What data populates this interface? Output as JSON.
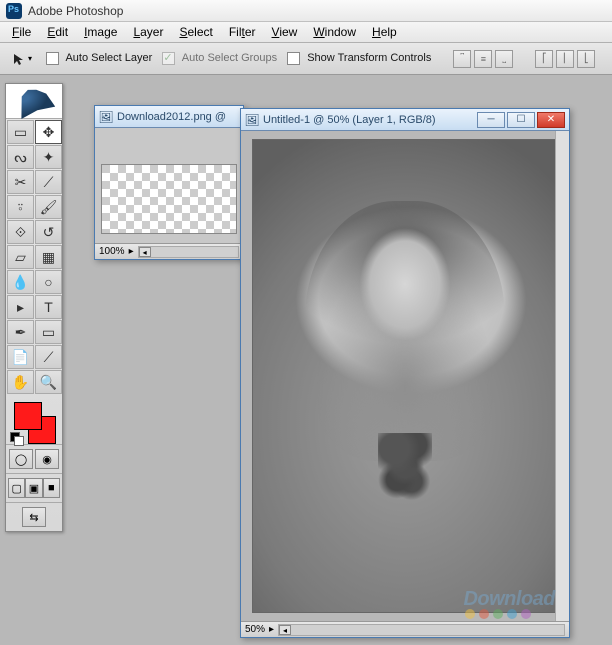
{
  "app": {
    "title": "Adobe Photoshop"
  },
  "menu": {
    "items": [
      "File",
      "Edit",
      "Image",
      "Layer",
      "Select",
      "Filter",
      "View",
      "Window",
      "Help"
    ]
  },
  "options": {
    "auto_select_layer": "Auto Select Layer",
    "auto_select_groups": "Auto Select Groups",
    "show_transform": "Show Transform Controls"
  },
  "tools": [
    "marquee",
    "move",
    "lasso",
    "magic-wand",
    "crop",
    "slice",
    "healing",
    "brush",
    "stamp",
    "history-brush",
    "eraser",
    "gradient",
    "blur",
    "dodge",
    "pen",
    "type",
    "path-select",
    "shape",
    "notes",
    "eyedropper",
    "hand",
    "zoom"
  ],
  "colors": {
    "fg": "#ff1a1a",
    "bg": "#ff1a1a"
  },
  "doc1": {
    "title": "Download2012.png @",
    "zoom": "100%"
  },
  "doc2": {
    "title": "Untitled-1 @ 50% (Layer 1, RGB/8)",
    "zoom": "50%"
  },
  "watermark": "Download",
  "dot_colors": [
    "#f0c040",
    "#e05a40",
    "#60b060",
    "#40a0d0",
    "#b060c0"
  ]
}
